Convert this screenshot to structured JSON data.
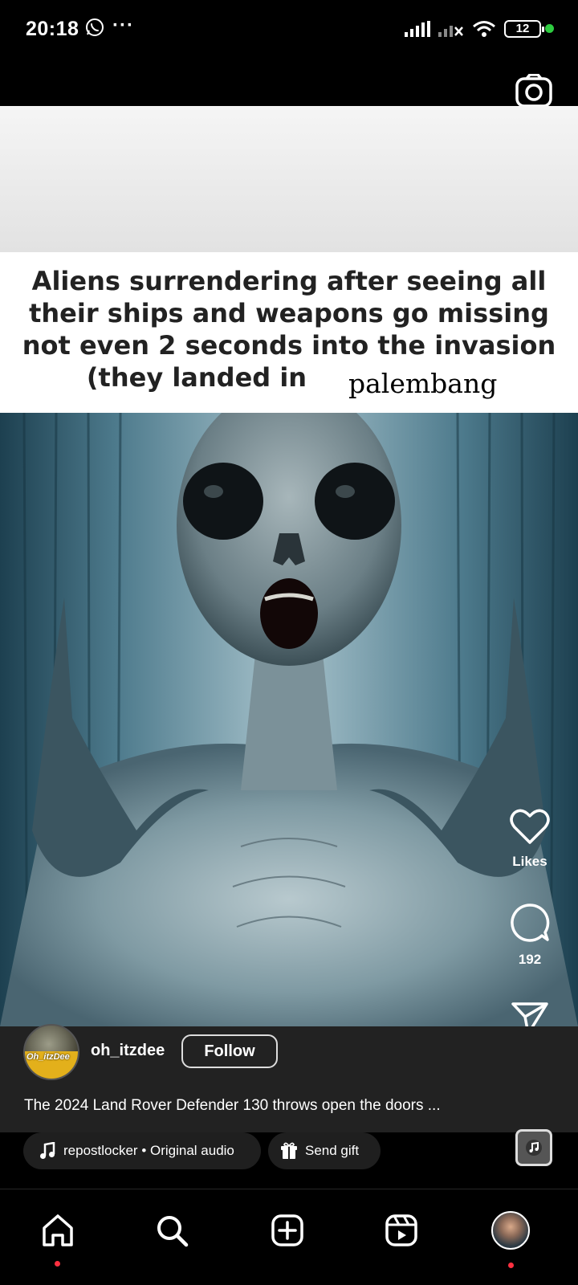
{
  "status_bar": {
    "time": "20:18",
    "battery": "12",
    "colors": {
      "connected_dot": "#2ecc40"
    }
  },
  "post": {
    "caption_lines": [
      "Aliens surrendering after seeing all",
      "their ships and weapons go missing",
      "not even 2 seconds into the invasion",
      "(they landed in"
    ],
    "place_tag": "palembang",
    "icons": {
      "camera": "camera-icon",
      "like": "heart-icon",
      "comment": "comment-icon",
      "share": "send-icon",
      "more": "more-vertical-icon"
    }
  },
  "actions": {
    "likes_label": "Likes",
    "comments_count": "192"
  },
  "author": {
    "avatar_text": "Oh_itzDee",
    "username": "oh_itzdee",
    "follow_label": "Follow"
  },
  "description": "The 2024 Land Rover Defender 130 throws open the doors ...",
  "audio": {
    "label": "repostlocker • Original audio",
    "icon": "music-note-icon"
  },
  "gift": {
    "label": "Send gift",
    "icon": "gift-icon"
  },
  "nav": {
    "items": [
      "home-icon",
      "search-icon",
      "create-icon",
      "reels-icon",
      "profile-avatar"
    ],
    "colors": {
      "notification_dot": "#ff3040"
    }
  }
}
